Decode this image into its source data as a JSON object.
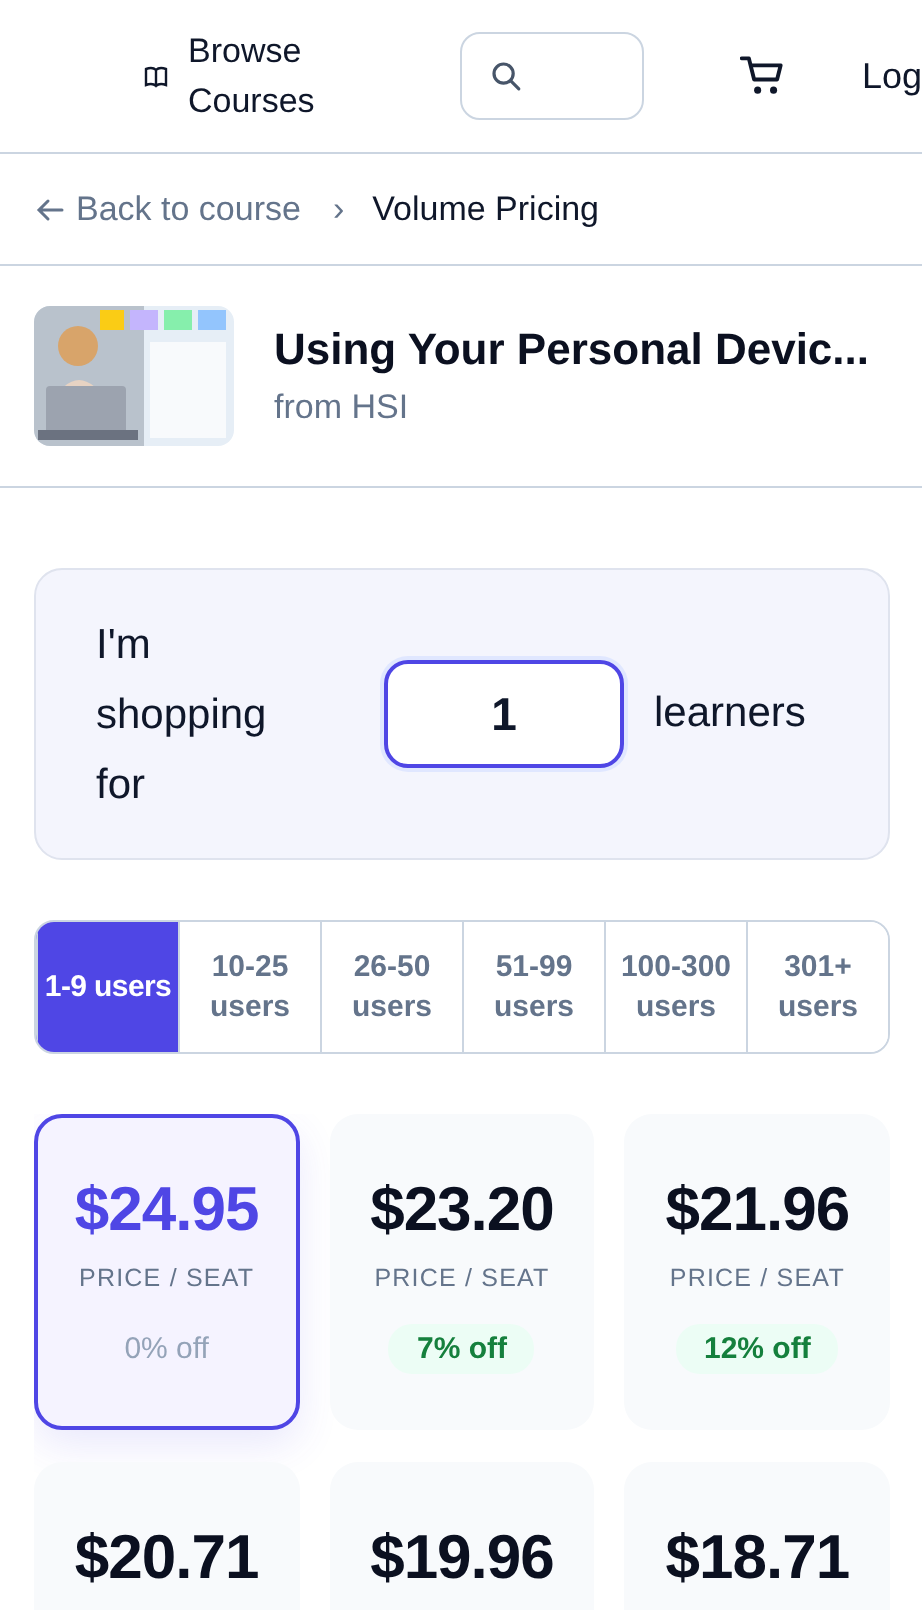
{
  "header": {
    "browse_label": "Browse Courses",
    "search": {
      "kind": "icon-field"
    },
    "login_label": "Log"
  },
  "breadcrumb": {
    "back_label": "Back to course",
    "separator": "›",
    "current": "Volume Pricing"
  },
  "course": {
    "title": "Using Your Personal Devic...",
    "provider": "from HSI"
  },
  "quantity": {
    "prefix": "I'm shopping for",
    "value": "1",
    "suffix": "learners"
  },
  "tiers": [
    {
      "label": "1-9 users",
      "selected": true
    },
    {
      "label": "10-25 users",
      "selected": false
    },
    {
      "label": "26-50 users",
      "selected": false
    },
    {
      "label": "51-99 users",
      "selected": false
    },
    {
      "label": "100-300 users",
      "selected": false
    },
    {
      "label": "301+ users",
      "selected": false
    }
  ],
  "cards": [
    {
      "price": "$24.95",
      "unit": "PRICE / SEAT",
      "discount": {
        "text": "0% off",
        "kind": "none"
      },
      "selected": true
    },
    {
      "price": "$23.20",
      "unit": "PRICE / SEAT",
      "discount": {
        "text": "7% off",
        "kind": "saving"
      },
      "selected": false
    },
    {
      "price": "$21.96",
      "unit": "PRICE / SEAT",
      "discount": {
        "text": "12% off",
        "kind": "saving"
      },
      "selected": false
    },
    {
      "price": "$20.71",
      "selected": false
    },
    {
      "price": "$19.96",
      "selected": false
    },
    {
      "price": "$18.71",
      "selected": false
    }
  ]
}
